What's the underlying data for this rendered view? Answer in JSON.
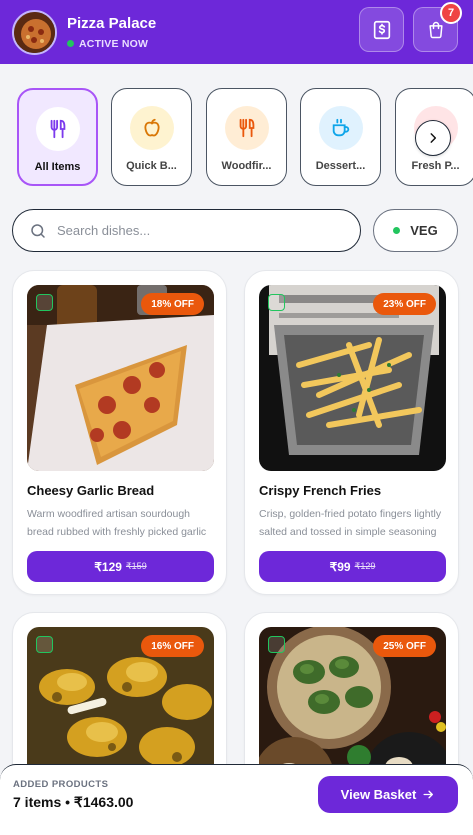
{
  "header": {
    "restaurant_name": "Pizza Palace",
    "status": "ACTIVE NOW",
    "cart_count": "7",
    "icons": [
      "receipt-icon",
      "shopping-bag-icon"
    ]
  },
  "categories": [
    {
      "label": "All Items",
      "icon": "fork-knife-icon",
      "active": true
    },
    {
      "label": "Quick B...",
      "icon": "apple-icon",
      "active": false
    },
    {
      "label": "Woodfir...",
      "icon": "fork-knife-icon",
      "active": false
    },
    {
      "label": "Dessert...",
      "icon": "coffee-cup-icon",
      "active": false
    },
    {
      "label": "Fresh P...",
      "icon": "bowl-icon",
      "active": false
    }
  ],
  "search": {
    "placeholder": "Search dishes...",
    "veg_label": "VEG"
  },
  "products": [
    {
      "name": "Cheesy Garlic Bread",
      "desc": "Warm woodfired artisan sourdough bread rubbed with freshly picked garlic",
      "discount": "18% OFF",
      "price": "₹129",
      "mrp": "₹159"
    },
    {
      "name": "Crispy French Fries",
      "desc": "Crisp, golden-fried potato fingers lightly salted and tossed in simple seasoning",
      "discount": "23% OFF",
      "price": "₹99",
      "mrp": "₹129"
    },
    {
      "name": "",
      "desc": "",
      "discount": "16% OFF",
      "price": "",
      "mrp": ""
    },
    {
      "name": "",
      "desc": "",
      "discount": "25% OFF",
      "price": "",
      "mrp": ""
    }
  ],
  "bottom": {
    "label": "ADDED PRODUCTS",
    "summary": "7 items • ₹1463.00",
    "button": "View Basket"
  },
  "colors": {
    "brand": "#6d28d9",
    "discount": "#ea580c",
    "veg": "#22c55e",
    "badge": "#ef4444"
  }
}
